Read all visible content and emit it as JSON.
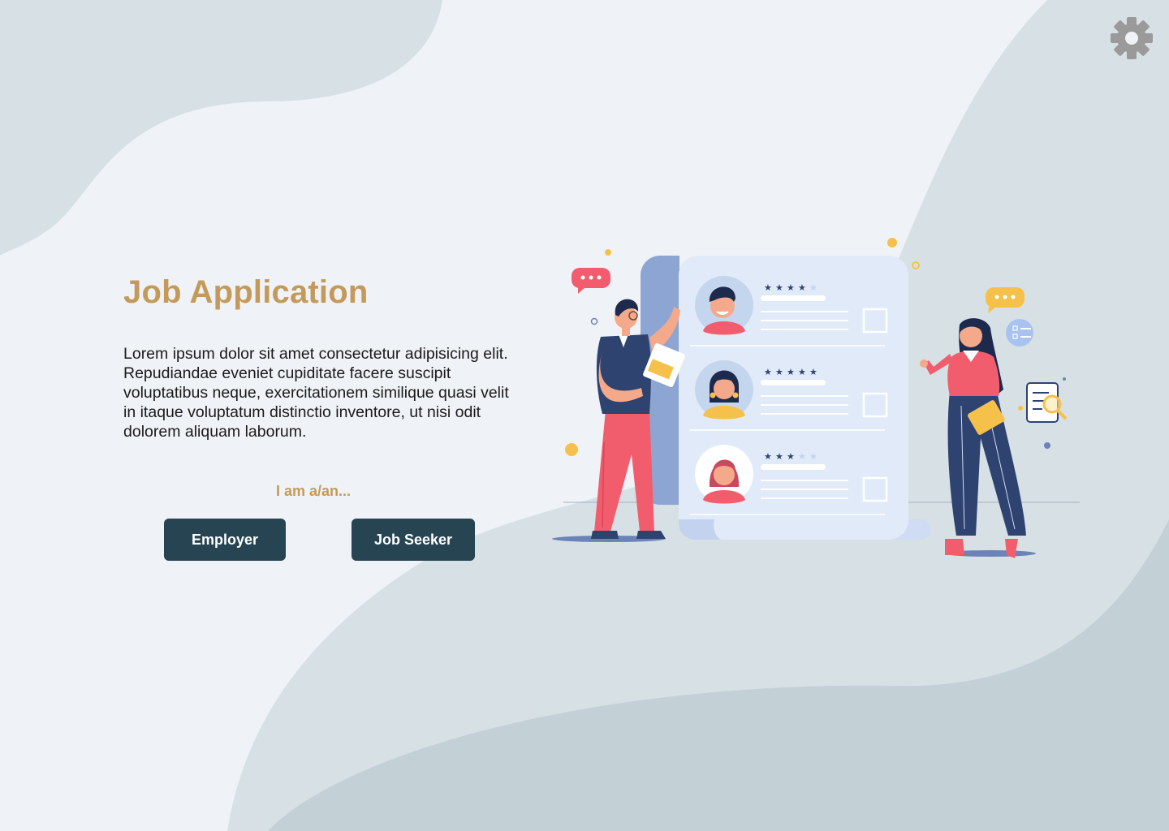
{
  "page": {
    "title": "Job Application",
    "description": "Lorem ipsum dolor sit amet consectetur adipisicing elit. Repudiandae eveniet cupiditate facere suscipit voluptatibus neque, exercitationem similique quasi velit in itaque voluptatum distinctio inventore, ut nisi odit dolorem aliquam laborum.",
    "role_prompt": "I am a/an..."
  },
  "buttons": {
    "employer": "Employer",
    "job_seeker": "Job Seeker"
  },
  "icons": {
    "settings": "gear-icon"
  },
  "illustration": {
    "candidates": [
      {
        "rating": 4,
        "max": 5
      },
      {
        "rating": 5,
        "max": 5
      },
      {
        "rating": 3,
        "max": 5
      }
    ]
  },
  "colors": {
    "background": "#eff3f7",
    "accent": "#c49a5b",
    "button": "#274452",
    "button_text": "#ffffff",
    "wave_light": "#d7e1e5",
    "wave_dark": "#c3d1d7",
    "gear": "#9a9a9a"
  }
}
